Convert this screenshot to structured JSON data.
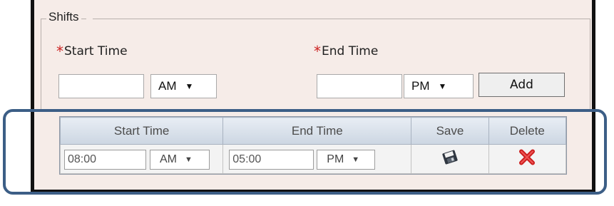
{
  "fieldset": {
    "legend": "Shifts"
  },
  "form": {
    "required_marker": "*",
    "start_time": {
      "label": "Start Time",
      "value": "",
      "ampm": "AM"
    },
    "end_time": {
      "label": "End Time",
      "value": "",
      "ampm": "PM"
    },
    "add_button": "Add",
    "dropdown_caret": "▼"
  },
  "grid": {
    "columns": [
      "Start Time",
      "End Time",
      "Save",
      "Delete"
    ],
    "rows": [
      {
        "start_time": "08:00",
        "start_ampm": "AM",
        "end_time": "05:00",
        "end_ampm": "PM",
        "save_icon": "save-disk-icon",
        "delete_icon": "delete-x-icon"
      }
    ]
  },
  "colors": {
    "panel_bg": "#f6ece8",
    "required": "#cc2222",
    "highlight_border": "#3c5e86",
    "delete_red": "#cc1f1f"
  }
}
